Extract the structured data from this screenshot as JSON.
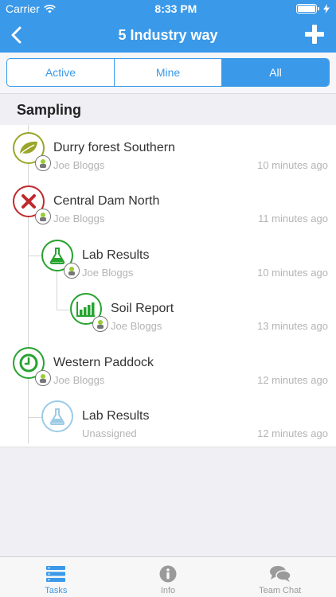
{
  "status_bar": {
    "carrier": "Carrier",
    "time": "8:33 PM"
  },
  "nav": {
    "title": "5 Industry way",
    "back_icon": "chevron-left-icon",
    "add_icon": "plus-icon"
  },
  "segments": [
    {
      "label": "Active",
      "selected": false
    },
    {
      "label": "Mine",
      "selected": false
    },
    {
      "label": "All",
      "selected": true
    }
  ],
  "section": {
    "title": "Sampling"
  },
  "tasks": [
    {
      "title": "Durry forest Southern",
      "assignee": "Joe Bloggs",
      "time": "10 minutes ago",
      "icon": "leaf-icon",
      "color": "#9aa62a",
      "indent": 0
    },
    {
      "title": "Central Dam North",
      "assignee": "Joe Bloggs",
      "time": "11 minutes ago",
      "icon": "x-mark-icon",
      "color": "#c0292d",
      "indent": 0
    },
    {
      "title": "Lab Results",
      "assignee": "Joe Bloggs",
      "time": "10 minutes ago",
      "icon": "flask-icon",
      "color": "#26a32f",
      "indent": 1
    },
    {
      "title": "Soil Report",
      "assignee": "Joe Bloggs",
      "time": "13 minutes ago",
      "icon": "bar-chart-icon",
      "color": "#26a32f",
      "indent": 2
    },
    {
      "title": "Western Paddock",
      "assignee": "Joe Bloggs",
      "time": "12 minutes ago",
      "icon": "clock-icon",
      "color": "#26a32f",
      "indent": 0
    },
    {
      "title": "Lab Results",
      "assignee": "Unassigned",
      "time": "12 minutes ago",
      "icon": "flask-icon",
      "color": "#9ccbe6",
      "indent": 1
    }
  ],
  "tabs": [
    {
      "label": "Tasks",
      "icon": "tasks-icon",
      "active": true
    },
    {
      "label": "Info",
      "icon": "info-icon",
      "active": false
    },
    {
      "label": "Team Chat",
      "icon": "chat-icon",
      "active": false
    }
  ],
  "colors": {
    "accent": "#3a99e9",
    "olive": "#9aa62a",
    "red": "#c0292d",
    "green": "#26a32f",
    "pale_blue": "#9ccbe6"
  }
}
